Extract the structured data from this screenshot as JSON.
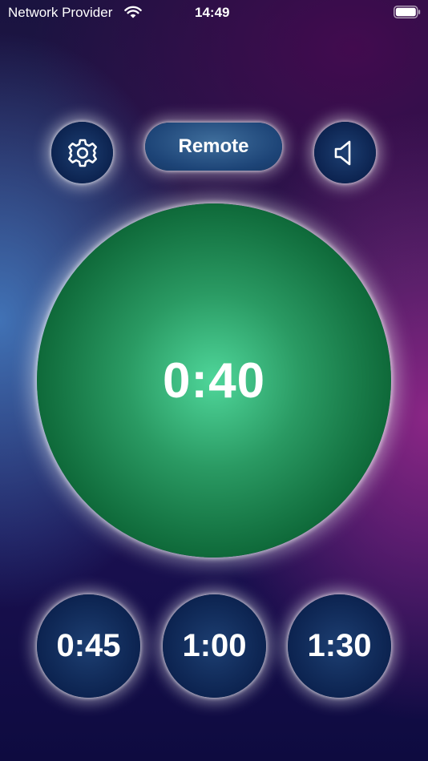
{
  "status_bar": {
    "carrier": "Network Provider",
    "time": "14:49",
    "wifi_icon": "wifi-icon",
    "battery_icon": "battery-full-icon"
  },
  "toolbar": {
    "settings_icon": "gear-icon",
    "remote_label": "Remote",
    "sound_icon": "speaker-icon"
  },
  "timer": {
    "value": "0:40",
    "color": "#2a9a63"
  },
  "presets": [
    {
      "label": "0:45"
    },
    {
      "label": "1:00"
    },
    {
      "label": "1:30"
    }
  ],
  "colors": {
    "button_fill": "#0c2350",
    "glow": "#ffffff",
    "timer_green": "#2a9a63"
  }
}
